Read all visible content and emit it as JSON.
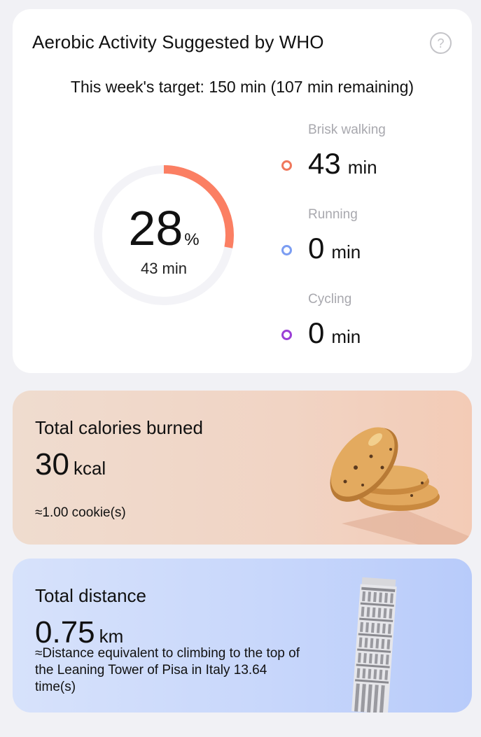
{
  "aerobic": {
    "title": "Aerobic Activity Suggested by WHO",
    "help_icon": "question-circle-icon",
    "target_text": "This week's target: 150 min (107 min remaining)",
    "progress": {
      "percent_value": "28",
      "percent_sign": "%",
      "minutes_text": "43 min",
      "fraction": 0.28,
      "color": "#fb7f63",
      "track_color": "#f3f3f7"
    },
    "activities": [
      {
        "label": "Brisk walking",
        "value": "43",
        "unit": "min",
        "color": "#f0785c"
      },
      {
        "label": "Running",
        "value": "0",
        "unit": "min",
        "color": "#7b9df2"
      },
      {
        "label": "Cycling",
        "value": "0",
        "unit": "min",
        "color": "#9b3fd6"
      }
    ]
  },
  "calories": {
    "title": "Total calories burned",
    "value": "30",
    "unit": "kcal",
    "equivalent": "≈1.00 cookie(s)",
    "illustration": "cookie-icon"
  },
  "distance": {
    "title": "Total distance",
    "value": "0.75",
    "unit": "km",
    "equivalent": "≈Distance equivalent to climbing to the top of the Leaning Tower of Pisa in Italy 13.64 time(s)",
    "illustration": "leaning-tower-icon"
  }
}
